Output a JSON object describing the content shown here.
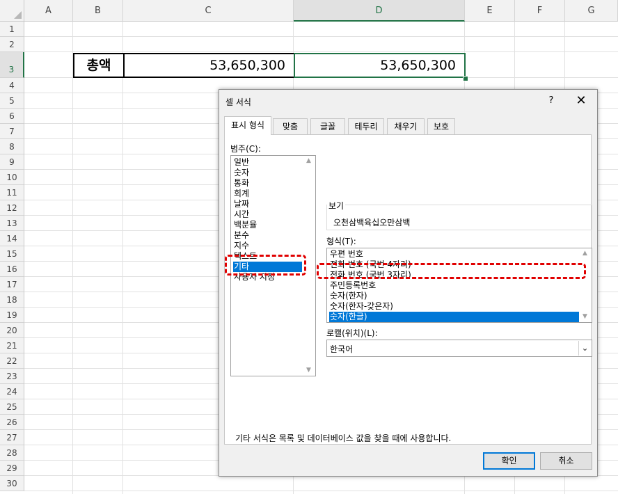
{
  "sheet": {
    "columns": [
      "A",
      "B",
      "C",
      "D",
      "E",
      "F",
      "G"
    ],
    "rows": [
      "1",
      "2",
      "3",
      "4",
      "5",
      "6",
      "7",
      "8",
      "9",
      "10",
      "11",
      "12",
      "13",
      "14",
      "15",
      "16",
      "17",
      "18",
      "19",
      "20",
      "21",
      "22",
      "23",
      "24",
      "25",
      "26",
      "27",
      "28",
      "29",
      "30"
    ],
    "selected_column": "D",
    "selected_row": "3",
    "cells": {
      "B3": "총액",
      "C3": "53,650,300",
      "D3": "53,650,300"
    }
  },
  "dialog": {
    "title": "셀 서식",
    "help_label": "?",
    "close_label": "✕",
    "tabs": [
      {
        "label": "표시 형식",
        "active": true
      },
      {
        "label": "맞춤",
        "active": false
      },
      {
        "label": "글꼴",
        "active": false
      },
      {
        "label": "테두리",
        "active": false
      },
      {
        "label": "채우기",
        "active": false
      },
      {
        "label": "보호",
        "active": false
      }
    ],
    "category_label": "범주(C):",
    "categories": [
      "일반",
      "숫자",
      "통화",
      "회계",
      "날짜",
      "시간",
      "백분율",
      "분수",
      "지수",
      "텍스트",
      "기타",
      "사용자 지정"
    ],
    "selected_category": "기타",
    "preview_label": "보기",
    "preview_value": "오천삼백육십오만삼백",
    "type_label": "형식(T):",
    "types": [
      "우편 번호",
      "전화 번호 (국번 4자리)",
      "전화 번호 (국번 3자리)",
      "주민등록번호",
      "숫자(한자)",
      "숫자(한자-갖은자)",
      "숫자(한글)"
    ],
    "selected_type": "숫자(한글)",
    "locale_label": "로캘(위치)(L):",
    "locale_value": "한국어",
    "description": "기타 서식은 목록 및 데이터베이스 값을 찾을 때에 사용합니다.",
    "ok_label": "확인",
    "cancel_label": "취소"
  },
  "colors": {
    "excel_green": "#217346",
    "selection_blue": "#0078d7",
    "highlight_red": "#e00000"
  }
}
